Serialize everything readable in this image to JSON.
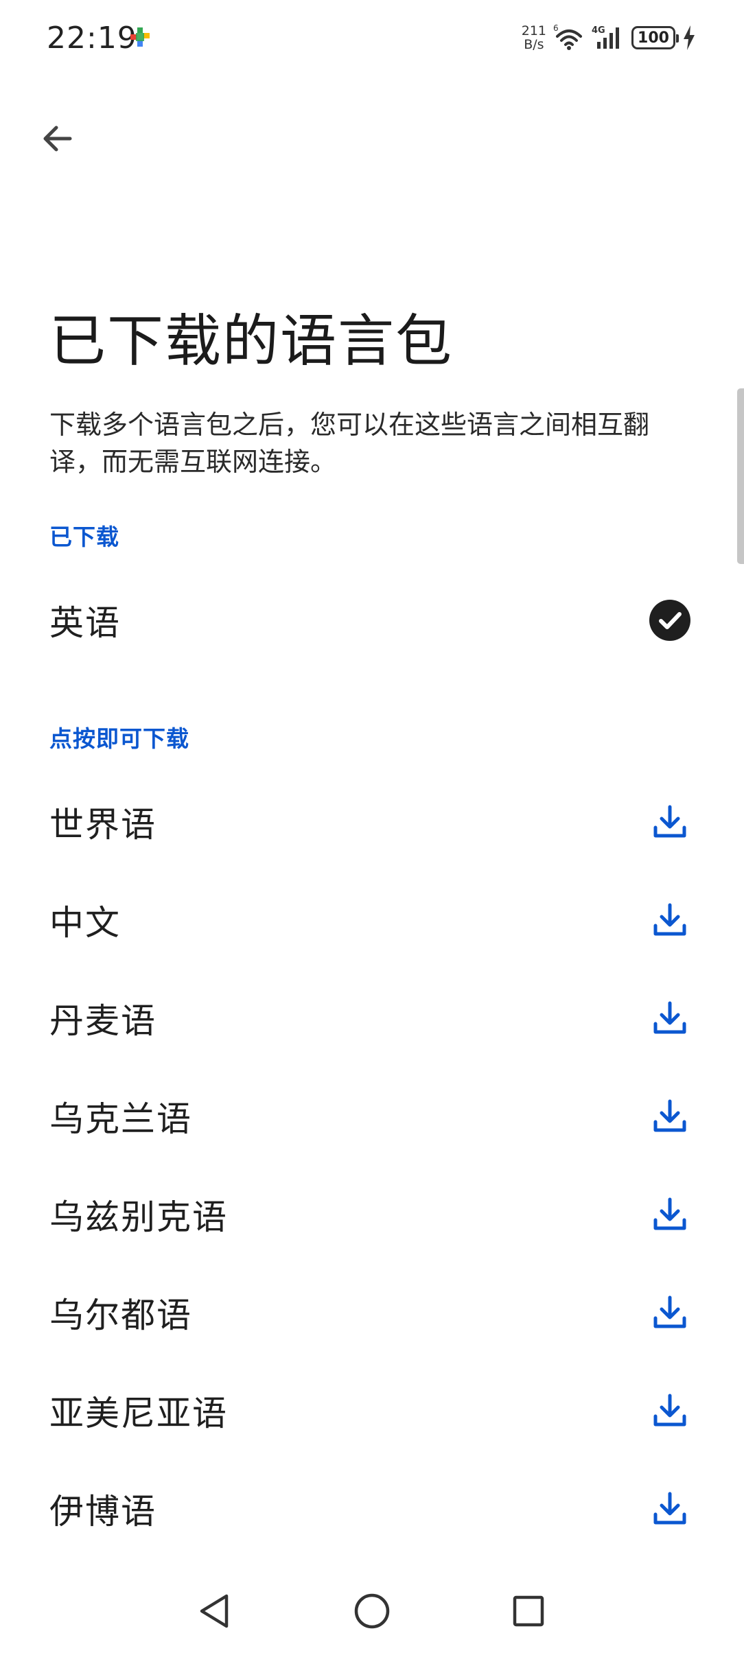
{
  "status_bar": {
    "time": "22:19",
    "net_speed_value": "211",
    "net_speed_unit": "B/s",
    "signal_label": "4G",
    "battery_level": "100"
  },
  "header": {
    "back_icon": "arrow-left-icon"
  },
  "page": {
    "title": "已下载的语言包",
    "description": "下载多个语言包之后，您可以在这些语言之间相互翻译，而无需互联网连接。"
  },
  "downloaded": {
    "label": "已下载",
    "items": [
      {
        "name": "英语",
        "icon": "check-circle-icon"
      }
    ]
  },
  "available": {
    "label": "点按即可下载",
    "items": [
      {
        "name": "世界语",
        "icon": "download-icon"
      },
      {
        "name": "中文",
        "icon": "download-icon"
      },
      {
        "name": "丹麦语",
        "icon": "download-icon"
      },
      {
        "name": "乌克兰语",
        "icon": "download-icon"
      },
      {
        "name": "乌兹别克语",
        "icon": "download-icon"
      },
      {
        "name": "乌尔都语",
        "icon": "download-icon"
      },
      {
        "name": "亚美尼亚语",
        "icon": "download-icon"
      },
      {
        "name": "伊博语",
        "icon": "download-icon"
      }
    ]
  },
  "colors": {
    "accent": "#0b57d0",
    "text": "#1f1f1f",
    "check_bg": "#1f1f1f"
  },
  "nav_bar": {
    "back_icon": "triangle-back-icon",
    "home_icon": "circle-home-icon",
    "recents_icon": "square-recents-icon"
  }
}
